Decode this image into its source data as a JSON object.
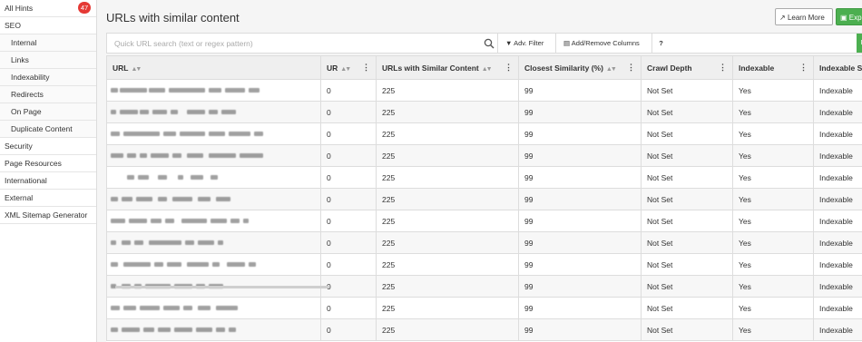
{
  "sidebar": {
    "items": [
      {
        "label": "All Hints",
        "badge": "47",
        "sub": false
      },
      {
        "label": "SEO",
        "sub": false
      },
      {
        "label": "Internal",
        "sub": true
      },
      {
        "label": "Links",
        "sub": true
      },
      {
        "label": "Indexability",
        "sub": true
      },
      {
        "label": "Redirects",
        "sub": true
      },
      {
        "label": "On Page",
        "sub": true
      },
      {
        "label": "Duplicate Content",
        "sub": true
      },
      {
        "label": "Security",
        "sub": false
      },
      {
        "label": "Page Resources",
        "sub": false
      },
      {
        "label": "International",
        "sub": false
      },
      {
        "label": "External",
        "sub": false
      },
      {
        "label": "XML Sitemap Generator",
        "sub": false
      }
    ]
  },
  "header": {
    "title": "URLs with similar content",
    "learn_more": "Learn More",
    "export": "Exp"
  },
  "toolbar": {
    "search_placeholder": "Quick URL search (text or regex pattern)",
    "adv_filter": "Adv. Filter",
    "add_remove_columns": "Add/Remove Columns",
    "help": "?",
    "green_chip": "E"
  },
  "table": {
    "columns": [
      {
        "label": "URL",
        "sortable": true,
        "menu": false
      },
      {
        "label": "UR",
        "sortable": true,
        "menu": true
      },
      {
        "label": "URLs with Similar Content",
        "sortable": true,
        "menu": true
      },
      {
        "label": "Closest Similarity (%)",
        "sortable": true,
        "menu": true
      },
      {
        "label": "Crawl Depth",
        "sortable": false,
        "menu": true
      },
      {
        "label": "Indexable",
        "sortable": false,
        "menu": true
      },
      {
        "label": "Indexable S",
        "sortable": false,
        "menu": false
      }
    ],
    "rows": [
      {
        "url": "",
        "ur": "0",
        "similar": "225",
        "closest": "99",
        "depth": "Not Set",
        "indexable": "Yes",
        "status": "Indexable"
      },
      {
        "url": "",
        "ur": "0",
        "similar": "225",
        "closest": "99",
        "depth": "Not Set",
        "indexable": "Yes",
        "status": "Indexable"
      },
      {
        "url": "",
        "ur": "0",
        "similar": "225",
        "closest": "99",
        "depth": "Not Set",
        "indexable": "Yes",
        "status": "Indexable"
      },
      {
        "url": "",
        "ur": "0",
        "similar": "225",
        "closest": "99",
        "depth": "Not Set",
        "indexable": "Yes",
        "status": "Indexable"
      },
      {
        "url": "",
        "ur": "0",
        "similar": "225",
        "closest": "99",
        "depth": "Not Set",
        "indexable": "Yes",
        "status": "Indexable"
      },
      {
        "url": "",
        "ur": "0",
        "similar": "225",
        "closest": "99",
        "depth": "Not Set",
        "indexable": "Yes",
        "status": "Indexable"
      },
      {
        "url": "",
        "ur": "0",
        "similar": "225",
        "closest": "99",
        "depth": "Not Set",
        "indexable": "Yes",
        "status": "Indexable"
      },
      {
        "url": "",
        "ur": "0",
        "similar": "225",
        "closest": "99",
        "depth": "Not Set",
        "indexable": "Yes",
        "status": "Indexable"
      },
      {
        "url": "",
        "ur": "0",
        "similar": "225",
        "closest": "99",
        "depth": "Not Set",
        "indexable": "Yes",
        "status": "Indexable"
      },
      {
        "url": "",
        "ur": "0",
        "similar": "225",
        "closest": "99",
        "depth": "Not Set",
        "indexable": "Yes",
        "status": "Indexable"
      },
      {
        "url": "",
        "ur": "0",
        "similar": "225",
        "closest": "99",
        "depth": "Not Set",
        "indexable": "Yes",
        "status": "Indexable"
      },
      {
        "url": "",
        "ur": "0",
        "similar": "225",
        "closest": "99",
        "depth": "Not Set",
        "indexable": "Yes",
        "status": "Indexable"
      }
    ]
  },
  "icons": {
    "learn_more": "external-link-icon",
    "export": "save-icon",
    "search": "search-icon",
    "filter": "filter-icon",
    "columns": "columns-icon",
    "sort": "sort-icon",
    "menu": "kebab-menu-icon"
  },
  "colors": {
    "badge": "#e53935",
    "accent": "#4caf50"
  }
}
